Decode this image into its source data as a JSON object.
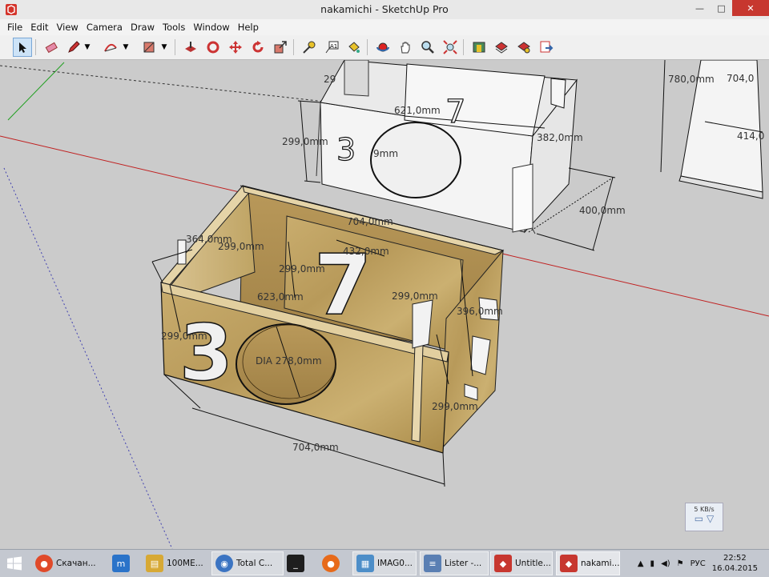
{
  "window": {
    "title": "nakamichi - SketchUp Pro",
    "minimize": "—",
    "maximize": "□",
    "close": "✕"
  },
  "menu": [
    "File",
    "Edit",
    "View",
    "Camera",
    "Draw",
    "Tools",
    "Window",
    "Help"
  ],
  "dimensions": {
    "back_top_width": "621,0mm",
    "back_left_height": "299,0mm",
    "back_inner": "9mm",
    "back_side": "382,0mm",
    "back_depth": "400,0mm",
    "back_partial": "29",
    "right_top": "780,0mm",
    "right_top2": "704,0",
    "right_side": "414,0",
    "front_top_width": "704,0mm",
    "front_left_top": "364,0mm",
    "front_inner_top": "299,0mm",
    "front_panel_width": "432,0mm",
    "front_panel_height": "299,0mm",
    "front_inner_width": "623,0mm",
    "front_inner_right": "299,0mm",
    "front_right_depth": "396,0mm",
    "front_left_height": "299,0mm",
    "front_hole": "DIA 278,0mm",
    "front_right_height": "299,0mm",
    "front_bottom_width": "704,0mm"
  },
  "digits": {
    "big_front_3": "3",
    "big_front_7": "7",
    "back_3": "3",
    "back_7": "7"
  },
  "network": {
    "speed": "5 KB/s"
  },
  "taskbar": {
    "items": [
      {
        "label": "Скачан...",
        "color": "#e04a2a"
      },
      {
        "label": "100ME...",
        "color": "#d7a935"
      },
      {
        "label": "Total C...",
        "color": "#3b74c2"
      },
      {
        "label": "",
        "color": "#1e1e1e"
      },
      {
        "label": "IMAG0...",
        "color": "#4d8ec8"
      },
      {
        "label": "Lister -...",
        "color": "#5a7fb3"
      },
      {
        "label": "Untitle...",
        "color": "#c7372f"
      },
      {
        "label": "nakami...",
        "color": "#c7372f"
      }
    ],
    "lang": "РУС",
    "time": "22:52",
    "date": "16.04.2015"
  }
}
